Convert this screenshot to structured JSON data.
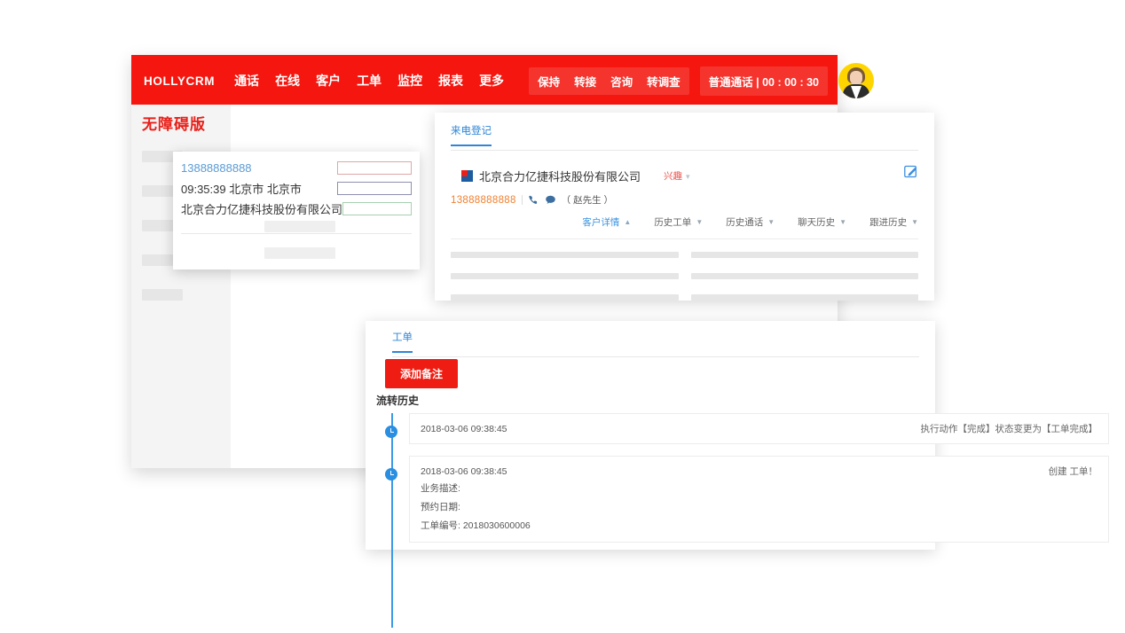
{
  "topbar": {
    "brand": "HOLLYCRM",
    "nav": [
      {
        "label": "通话"
      },
      {
        "label": "在线"
      },
      {
        "label": "客户"
      },
      {
        "label": "工单"
      },
      {
        "label": "监控"
      },
      {
        "label": "报表"
      },
      {
        "label": "更多"
      }
    ],
    "actions": [
      {
        "label": "保持"
      },
      {
        "label": "转接"
      },
      {
        "label": "咨询"
      },
      {
        "label": "转调查"
      }
    ],
    "call_status": "普通通话 | 00 : 00 : 30",
    "avatar_icon": "user-avatar-icon",
    "bg_color": "#f4160f"
  },
  "sidebar": {
    "accessible_label": "无障碍版",
    "accessible_color": "#e8201a",
    "placeholder_count": 5
  },
  "popup_card": {
    "rows": [
      {
        "text": "13888888888",
        "box": "b1"
      },
      {
        "text": "09:35:39 北京市 北京市",
        "box": "b2"
      },
      {
        "text": "北京合力亿捷科技股份有限公司",
        "box": "b3"
      }
    ],
    "placeholder_count": 2
  },
  "call_card": {
    "tab_label": "来电登记",
    "company_name": "北京合力亿捷科技股份有限公司",
    "company_logo_icon": "company-logo-icon",
    "interest_tag": "兴趣",
    "edit_icon": "edit-pencil-icon",
    "phone": "13888888888",
    "phone_icon": "phone-icon",
    "chat_icon": "chat-bubble-icon",
    "contact": "（ 赵先生 ）",
    "detail_tabs": [
      {
        "label": "客户详情",
        "state": "expanded",
        "active": true
      },
      {
        "label": "历史工单",
        "state": "collapsed",
        "active": false
      },
      {
        "label": "历史通话",
        "state": "collapsed",
        "active": false
      },
      {
        "label": "聊天历史",
        "state": "collapsed",
        "active": false
      },
      {
        "label": "跟进历史",
        "state": "collapsed",
        "active": false
      }
    ],
    "skeleton_rows": 3,
    "skeleton_cols": 2
  },
  "work_order_card": {
    "tab_label": "工单",
    "add_note_label": "添加备注",
    "add_note_color": "#ee1c12",
    "flow_history_title": "流转历史",
    "timeline": [
      {
        "date": "2018-03-06 09:38:45",
        "action": "执行动作【完成】状态变更为【工单完成】",
        "details": [],
        "clock_icon": "clock-icon"
      },
      {
        "date": "2018-03-06 09:38:45",
        "action": "创建 工单！",
        "details": [
          "业务描述:",
          "预约日期:",
          "工单编号: 2018030600006"
        ],
        "clock_icon": "clock-icon"
      }
    ]
  }
}
